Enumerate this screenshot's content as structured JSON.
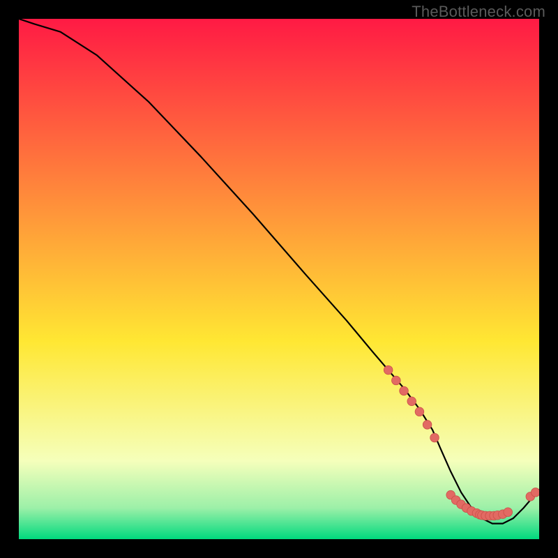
{
  "watermark": "TheBottleneck.com",
  "colors": {
    "curve_stroke": "#000000",
    "marker_fill": "#e26a63",
    "marker_stroke": "#c94f47",
    "bg_top": "#ff1a44",
    "bg_yellow": "#ffe733",
    "bg_pale": "#f5ffbb",
    "bg_green_light": "#9cf0a8",
    "bg_green": "#00d97e"
  },
  "chart_data": {
    "type": "line",
    "title": "",
    "xlabel": "",
    "ylabel": "",
    "xlim": [
      0,
      100
    ],
    "ylim": [
      0,
      100
    ],
    "x": [
      0,
      3,
      8,
      15,
      25,
      35,
      45,
      55,
      63,
      68,
      71,
      74,
      77,
      79.5,
      81,
      83,
      85,
      87,
      89,
      91,
      93,
      95,
      97,
      100
    ],
    "y": [
      100,
      99,
      97.5,
      93,
      84,
      73.5,
      62.5,
      51,
      42,
      36,
      32.5,
      29,
      25,
      21,
      17.5,
      13,
      9,
      6,
      4,
      3,
      3,
      4,
      6,
      9.5
    ],
    "markers": [
      {
        "x": 71.0,
        "y": 32.5
      },
      {
        "x": 72.5,
        "y": 30.5
      },
      {
        "x": 74.0,
        "y": 28.5
      },
      {
        "x": 75.5,
        "y": 26.5
      },
      {
        "x": 77.0,
        "y": 24.5
      },
      {
        "x": 78.5,
        "y": 22.0
      },
      {
        "x": 79.9,
        "y": 19.5
      },
      {
        "x": 83.0,
        "y": 8.5
      },
      {
        "x": 84.0,
        "y": 7.5
      },
      {
        "x": 85.0,
        "y": 6.7
      },
      {
        "x": 86.0,
        "y": 6.0
      },
      {
        "x": 87.0,
        "y": 5.4
      },
      {
        "x": 88.0,
        "y": 5.0
      },
      {
        "x": 88.6,
        "y": 4.7
      },
      {
        "x": 89.0,
        "y": 4.6
      },
      {
        "x": 89.7,
        "y": 4.5
      },
      {
        "x": 90.5,
        "y": 4.5
      },
      {
        "x": 91.3,
        "y": 4.5
      },
      {
        "x": 92.0,
        "y": 4.6
      },
      {
        "x": 93.0,
        "y": 4.8
      },
      {
        "x": 94.0,
        "y": 5.2
      },
      {
        "x": 98.3,
        "y": 8.2
      },
      {
        "x": 99.3,
        "y": 9.0
      }
    ]
  }
}
